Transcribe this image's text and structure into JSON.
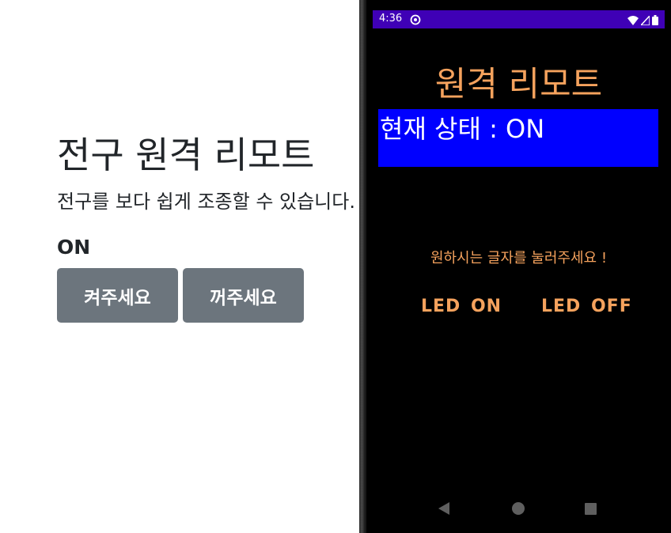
{
  "web": {
    "title": "전구 원격 리모트",
    "lead": "전구를 보다 쉽게 조종할 수 있습니다.",
    "status": "ON",
    "on_button": "켜주세요",
    "off_button": "꺼주세요",
    "button_color": "#6c757d"
  },
  "phone": {
    "status_bar": {
      "time": "4:36",
      "icons": [
        "sync-icon",
        "wifi-icon",
        "signal-icon",
        "battery-icon"
      ],
      "color": "#3f00b6"
    },
    "app_title": "원격 리모트",
    "state_text": "현재 상태 : ON",
    "state_box_color": "#0000ff",
    "instruction": "원하시는 글자를 눌러주세요 !",
    "led_on": "LED ON",
    "led_off": "LED OFF",
    "accent_color": "#f5a25d",
    "nav_icons": [
      "back-icon",
      "home-icon",
      "recent-apps-icon"
    ]
  }
}
